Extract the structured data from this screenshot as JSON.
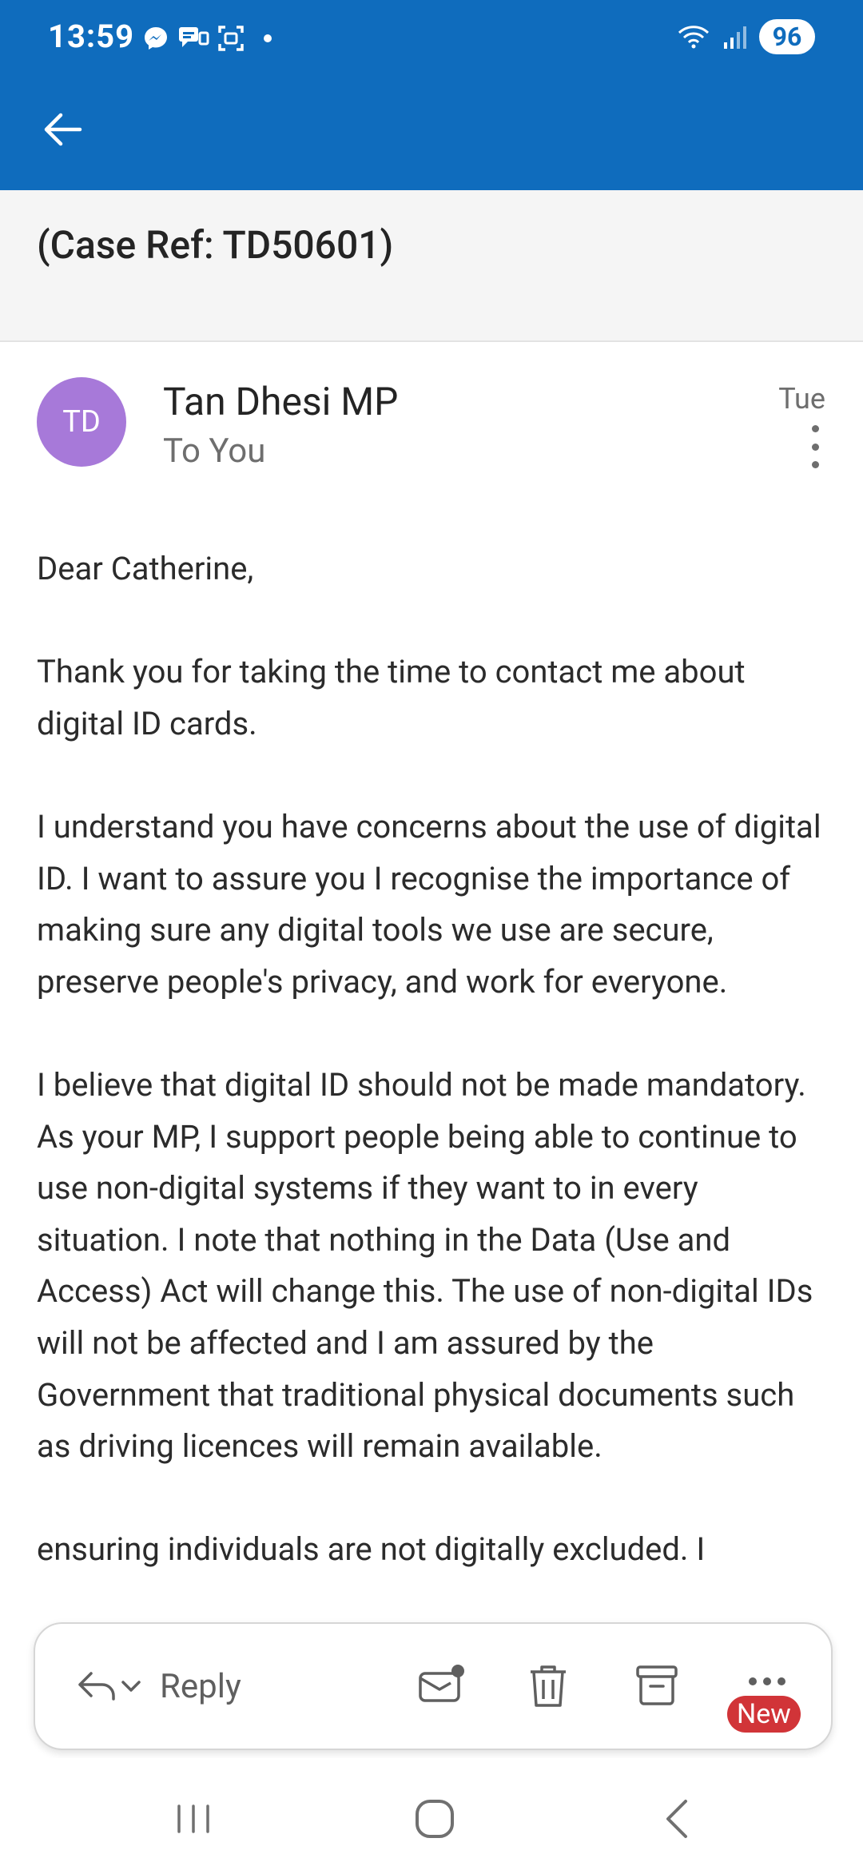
{
  "status_bar": {
    "time": "13:59",
    "battery": "96",
    "icons": [
      "messenger-icon",
      "chat-icon",
      "screenshot-icon",
      "wifi-icon",
      "signal-icon"
    ]
  },
  "toolbar": {
    "back_icon": "arrow-left-icon"
  },
  "email": {
    "subject": "(Case Ref: TD50601)",
    "avatar_initials": "TD",
    "avatar_color": "#a779d9",
    "sender": "Tan Dhesi MP",
    "recipient": "To You",
    "date": "Tue",
    "body": [
      "Dear Catherine,",
      "Thank you for taking the time to contact me about digital ID cards.",
      "I understand you have concerns about the use of digital ID. I want to assure you I recognise the importance of making sure any digital tools we use are secure, preserve people's privacy, and work for everyone.",
      "I believe that digital ID should not be made mandatory. As your MP, I support people being able to continue to use non-digital systems if they want to in every situation. I note that nothing in the Data (Use and Access) Act will change this. The use of non-digital IDs will not be affected and I am assured by the Government that traditional physical documents such as driving licences will remain available.",
      "ensuring individuals are not digitally excluded. I"
    ]
  },
  "action_bar": {
    "reply_label": "Reply",
    "new_badge": "New",
    "icons": [
      "reply-icon",
      "chevron-down-icon",
      "mark-unread-icon",
      "delete-icon",
      "archive-icon",
      "more-horizontal-icon"
    ]
  },
  "colors": {
    "brand": "#0f6cbd",
    "badge": "#d13438"
  }
}
